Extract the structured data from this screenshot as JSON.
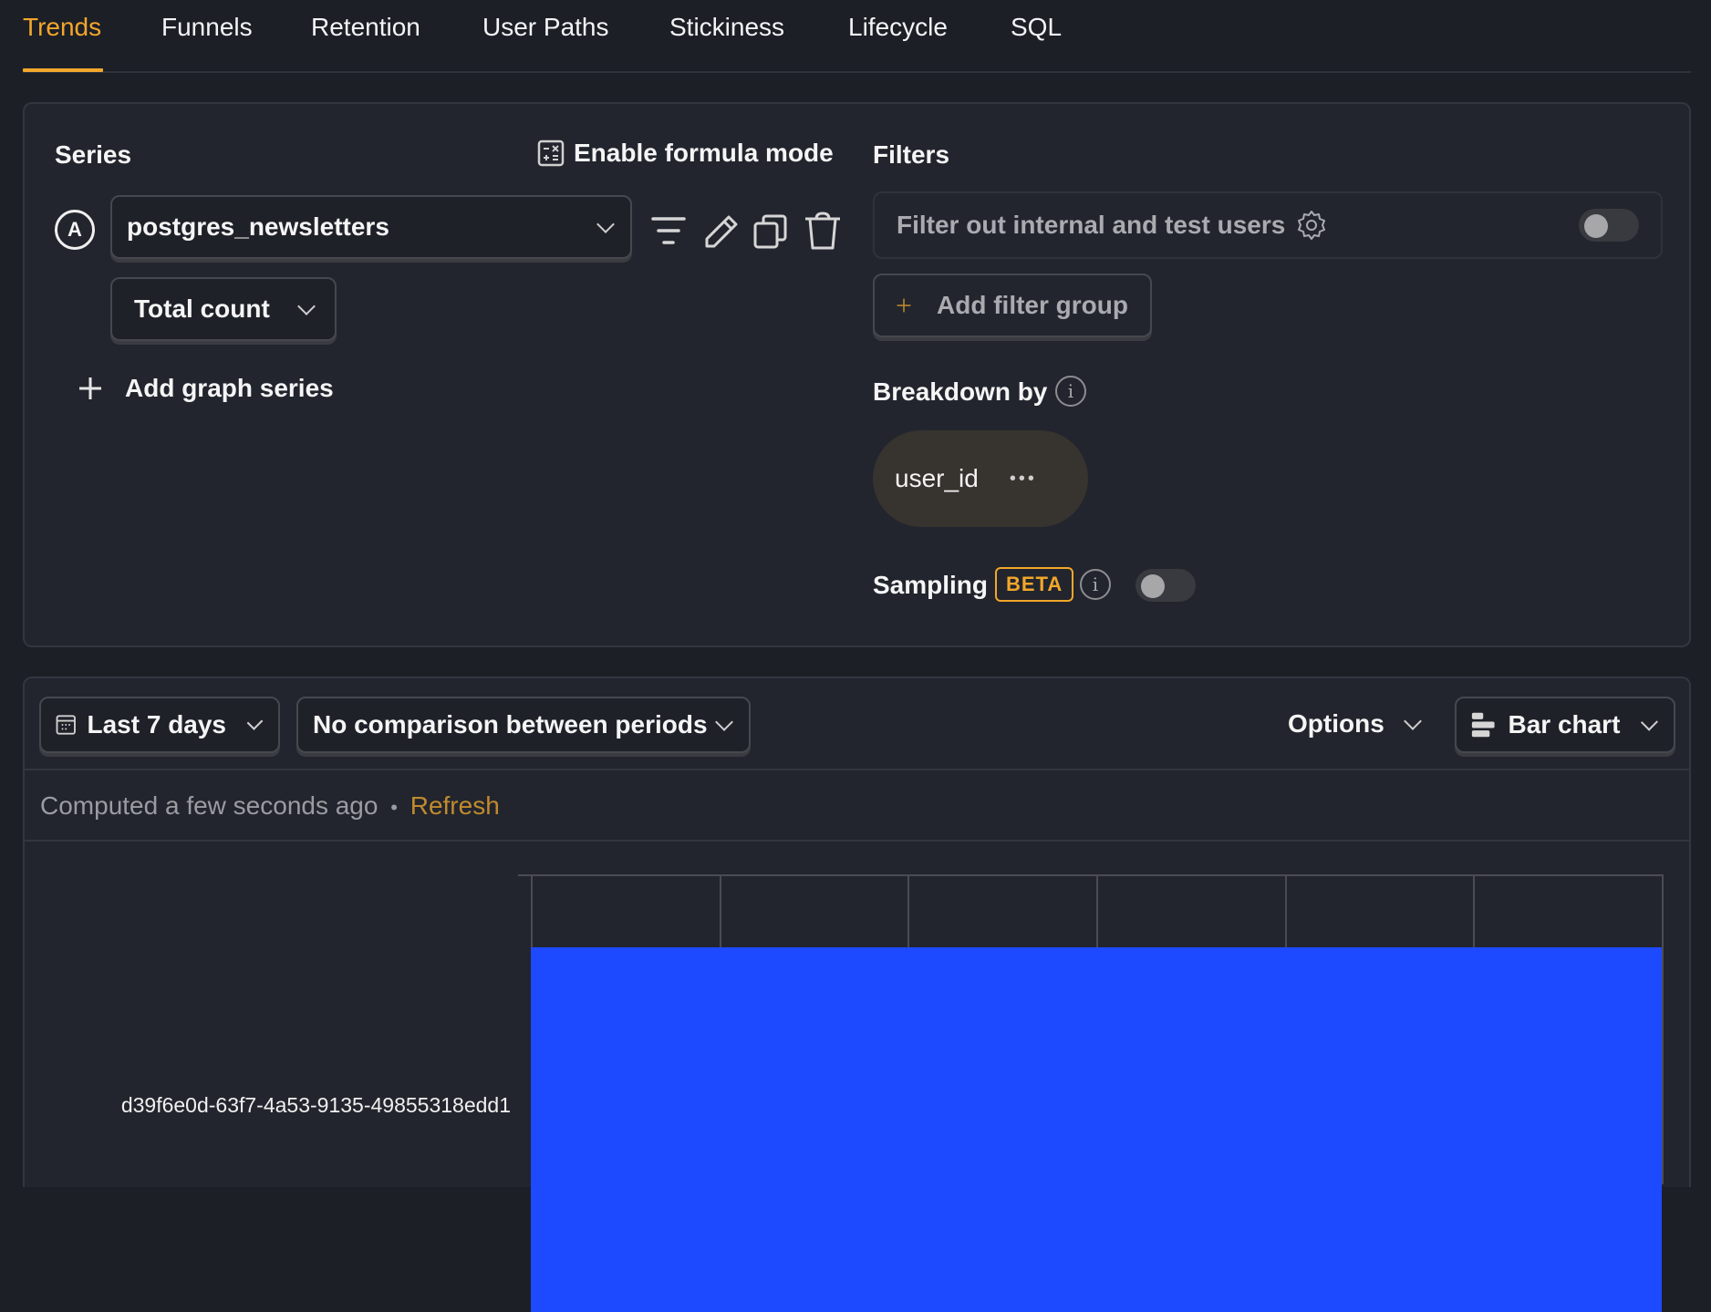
{
  "tabs": [
    {
      "label": "Trends",
      "active": true
    },
    {
      "label": "Funnels",
      "active": false
    },
    {
      "label": "Retention",
      "active": false
    },
    {
      "label": "User Paths",
      "active": false
    },
    {
      "label": "Stickiness",
      "active": false
    },
    {
      "label": "Lifecycle",
      "active": false
    },
    {
      "label": "SQL",
      "active": false
    }
  ],
  "series": {
    "heading": "Series",
    "formula_mode_label": "Enable formula mode",
    "items": [
      {
        "letter": "A",
        "event": "postgres_newsletters",
        "math": "Total count"
      }
    ],
    "add_series_label": "Add graph series",
    "action_icons": [
      "filter-icon",
      "edit-icon",
      "duplicate-icon",
      "delete-icon"
    ]
  },
  "filters": {
    "heading": "Filters",
    "test_account_filter_label": "Filter out internal and test users",
    "test_account_filter_enabled": false,
    "add_filter_group_label": "Add filter group"
  },
  "breakdown": {
    "heading": "Breakdown by",
    "items": [
      {
        "label": "user_id",
        "more": "•••"
      }
    ]
  },
  "sampling": {
    "heading": "Sampling",
    "badge": "BETA",
    "enabled": false
  },
  "controls": {
    "date_range": "Last 7 days",
    "compare": "No comparison between periods",
    "options_label": "Options",
    "display_type": "Bar chart"
  },
  "status": {
    "computed_text": "Computed a few seconds ago",
    "separator": "•",
    "refresh_label": "Refresh"
  },
  "colors": {
    "accent": "#f2a72b",
    "bar": "#1d4aff",
    "background": "#1d1f27",
    "panel": "#22252d"
  },
  "chart_data": {
    "type": "bar",
    "orientation": "horizontal",
    "categories": [
      "d39f6e0d-63f7-4a53-9135-49855318edd1"
    ],
    "series": [
      {
        "name": "postgres_newsletters",
        "values": [
          1
        ]
      }
    ],
    "xlim": [
      0,
      1.2
    ],
    "x_gridlines": 6,
    "title": "",
    "xlabel": "",
    "ylabel": "",
    "grid": true
  }
}
